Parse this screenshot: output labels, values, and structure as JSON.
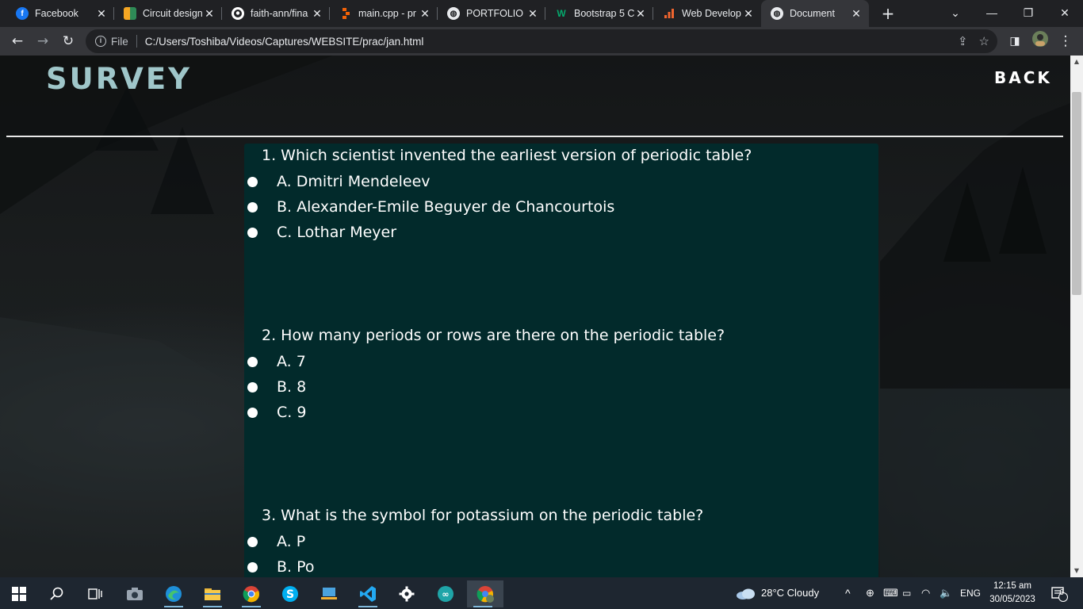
{
  "browser": {
    "tabs": [
      {
        "title": "Facebook",
        "icon": "facebook-icon",
        "color": "#1877f2"
      },
      {
        "title": "Circuit design",
        "icon": "circuits-icon",
        "color": "#f5a623"
      },
      {
        "title": "faith-ann/fina",
        "icon": "github-icon",
        "color": "#ffffff"
      },
      {
        "title": "main.cpp - pr",
        "icon": "replit-icon",
        "color": "#f26207"
      },
      {
        "title": "PORTFOLIO",
        "icon": "globe-icon",
        "color": "#e8eaed"
      },
      {
        "title": "Bootstrap 5 C",
        "icon": "w3schools-icon",
        "color": "#04aa6d"
      },
      {
        "title": "Web Develop",
        "icon": "chart-icon",
        "color": "#f0652f"
      },
      {
        "title": "Document",
        "icon": "globe-icon",
        "color": "#e8eaed"
      }
    ],
    "address": {
      "scheme_label": "File",
      "url": "C:/Users/Toshiba/Videos/Captures/WEBSITE/prac/jan.html"
    }
  },
  "page": {
    "logo": "SURVEY",
    "back_label": "BACK",
    "accent_color": "#9fc6c9",
    "panel_color": "#022a2b",
    "questions": [
      {
        "text": "1. Which scientist invented the earliest version of periodic table?",
        "options": [
          "A. Dmitri Mendeleev",
          "B. Alexander-Emile Beguyer de Chancourtois",
          "C. Lothar Meyer"
        ]
      },
      {
        "text": "2. How many periods or rows are there on the periodic table?",
        "options": [
          "A. 7",
          "B. 8",
          "C. 9"
        ]
      },
      {
        "text": "3. What is the symbol for potassium on the periodic table?",
        "options": [
          "A. P",
          "B. Po"
        ]
      }
    ]
  },
  "taskbar": {
    "weather": "28°C  Cloudy",
    "language": "ENG",
    "time": "12:15 am",
    "date": "30/05/2023",
    "notification_count": "6"
  }
}
